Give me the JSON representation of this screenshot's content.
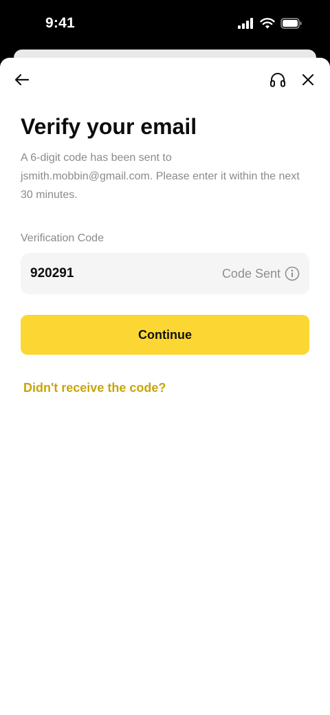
{
  "status_bar": {
    "time": "9:41",
    "icons": [
      "cellular-signal-icon",
      "wifi-icon",
      "battery-icon"
    ]
  },
  "nav": {
    "back_icon": "arrow-left-icon",
    "support_icon": "headset-icon",
    "close_icon": "close-icon"
  },
  "page": {
    "title": "Verify your email",
    "description": "A 6-digit code has been sent to jsmith.mobbin@gmail.com. Please enter it within the next 30 minutes."
  },
  "verification": {
    "label": "Verification Code",
    "value": "920291",
    "status": "Code Sent",
    "status_icon": "info-icon"
  },
  "actions": {
    "continue_label": "Continue",
    "resend_label": "Didn't receive the code?"
  },
  "colors": {
    "accent": "#fcd733",
    "link": "#c9a40b",
    "muted_text": "#8a8a8e",
    "field_bg": "#f5f5f5"
  }
}
